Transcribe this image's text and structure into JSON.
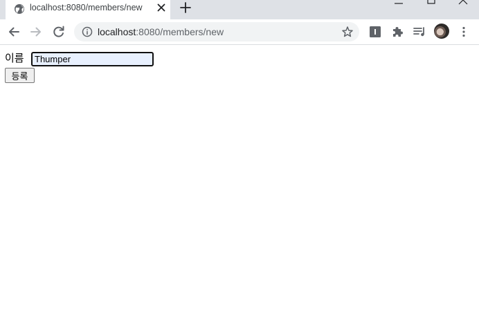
{
  "browser": {
    "tab": {
      "title": "localhost:8080/members/new"
    },
    "address_bar": {
      "host": "localhost",
      "rest": ":8080/members/new"
    }
  },
  "icons": {
    "favicon": "globe-icon",
    "close": "close-icon",
    "new_tab": "plus-icon",
    "back": "back-arrow-icon",
    "forward": "forward-arrow-icon",
    "reload": "reload-icon",
    "site_info": "info-icon",
    "bookmark": "star-icon",
    "extension_badge": "extension-badge-icon",
    "extensions": "puzzle-icon",
    "reading_list": "reading-list-icon",
    "menu": "three-dots-icon"
  },
  "form": {
    "name_label": "이름",
    "name_value": "Thumper",
    "submit_label": "등록"
  },
  "colors": {
    "tabstrip_bg": "#dee1e6",
    "omnibox_bg": "#f1f3f4",
    "autofill_bg": "#e8f0fe"
  }
}
